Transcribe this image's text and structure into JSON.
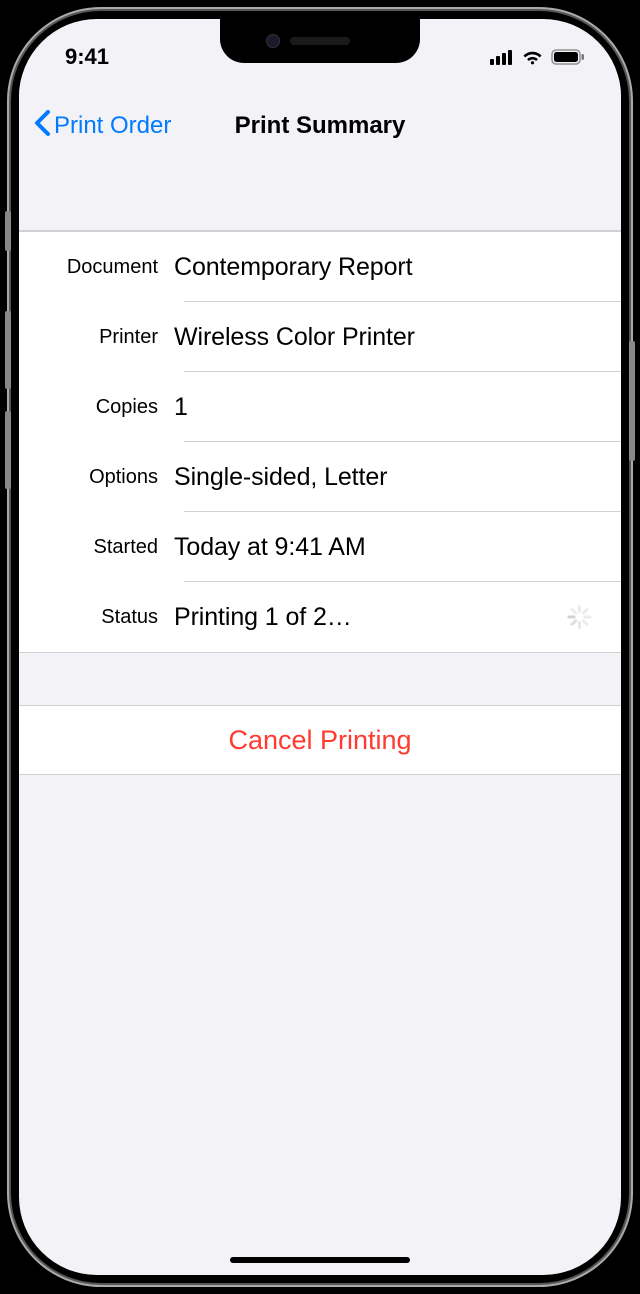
{
  "statusBar": {
    "time": "9:41"
  },
  "nav": {
    "back": "Print Order",
    "title": "Print Summary"
  },
  "rows": {
    "document": {
      "label": "Document",
      "value": "Contemporary Report"
    },
    "printer": {
      "label": "Printer",
      "value": "Wireless Color Printer"
    },
    "copies": {
      "label": "Copies",
      "value": "1"
    },
    "options": {
      "label": "Options",
      "value": "Single-sided, Letter"
    },
    "started": {
      "label": "Started",
      "value": "Today at  9:41 AM"
    },
    "status": {
      "label": "Status",
      "value": "Printing 1 of 2…"
    }
  },
  "cancel": "Cancel Printing"
}
